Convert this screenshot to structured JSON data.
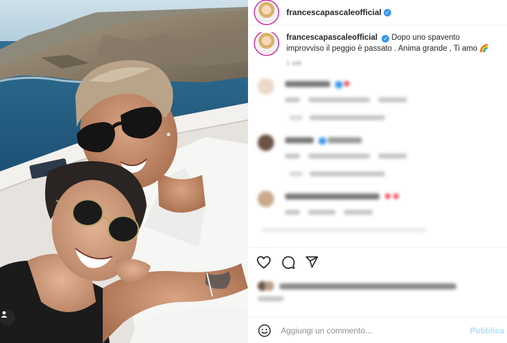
{
  "post": {
    "username": "francescapascaleofficial",
    "caption_username": "francescapascaleofficial",
    "caption_text": "Dopo uno spavento improvviso il peggio è passato . Anima grande , Ti amo",
    "caption_emoji": "🌈",
    "time_ago": "1 sett"
  },
  "actions": {
    "like_icon": "heart-icon",
    "comment_icon": "comment-icon",
    "share_icon": "paper-plane-icon"
  },
  "comment_box": {
    "placeholder": "Aggiungi un commento...",
    "publish_label": "Pubblica"
  },
  "colors": {
    "verified": "#3897f0",
    "link_blue": "#0095f6",
    "heart_red": "#ed4956",
    "story_ring": "#d6249f"
  }
}
